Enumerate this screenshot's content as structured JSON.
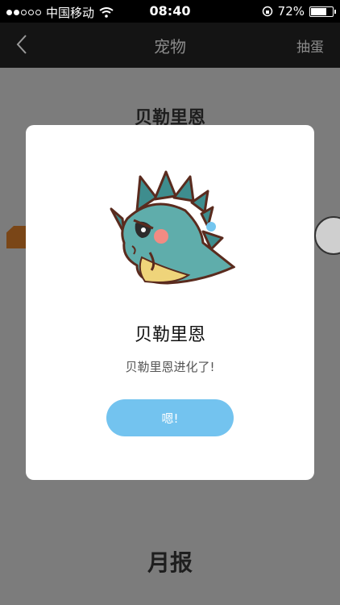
{
  "status_bar": {
    "carrier": "中国移动",
    "time": "08:40",
    "battery_text": "72%",
    "battery_level": 0.72,
    "signal_filled": 2,
    "signal_total": 5
  },
  "nav": {
    "back_icon": "chevron-left-icon",
    "title": "宠物",
    "right_action": "抽蛋"
  },
  "background": {
    "pet_name": "贝勒里恩",
    "section_title": "月报"
  },
  "dialog": {
    "pet_name": "贝勒里恩",
    "message": "贝勒里恩进化了!",
    "confirm_label": "嗯!",
    "accent_color": "#73c3ef"
  }
}
